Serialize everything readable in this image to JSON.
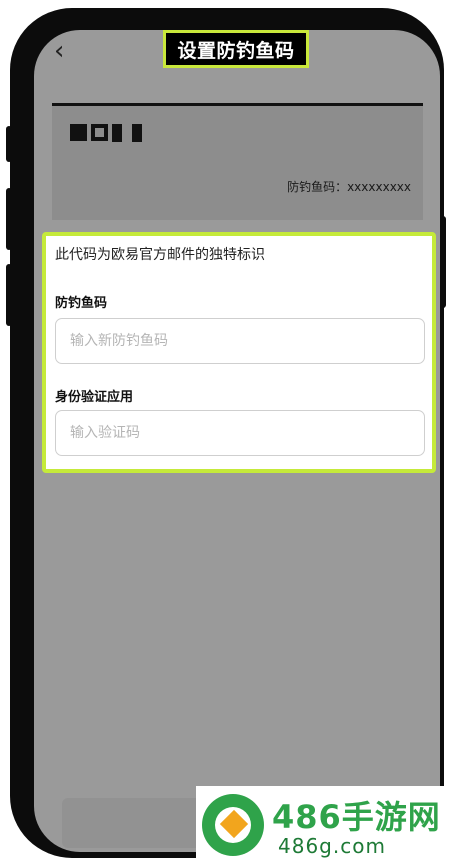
{
  "header": {
    "back_icon": "chevron-left-icon",
    "title": "设置防钓鱼码"
  },
  "banner": {
    "logo": "OKX",
    "code_text": "防钓鱼码：xxxxxxxxx"
  },
  "form": {
    "description": "此代码为欧易官方邮件的独特标识",
    "code_label": "防钓鱼码",
    "code_placeholder": "输入新防钓鱼码",
    "auth_label": "身份验证应用",
    "auth_placeholder": "输入验证码"
  },
  "watermark": {
    "title": "486手游网",
    "url": "486g.com"
  },
  "colors": {
    "highlight": "#c5ea3a",
    "dim_overlay": "#9a9a9a",
    "watermark_green": "#2fa34a"
  }
}
